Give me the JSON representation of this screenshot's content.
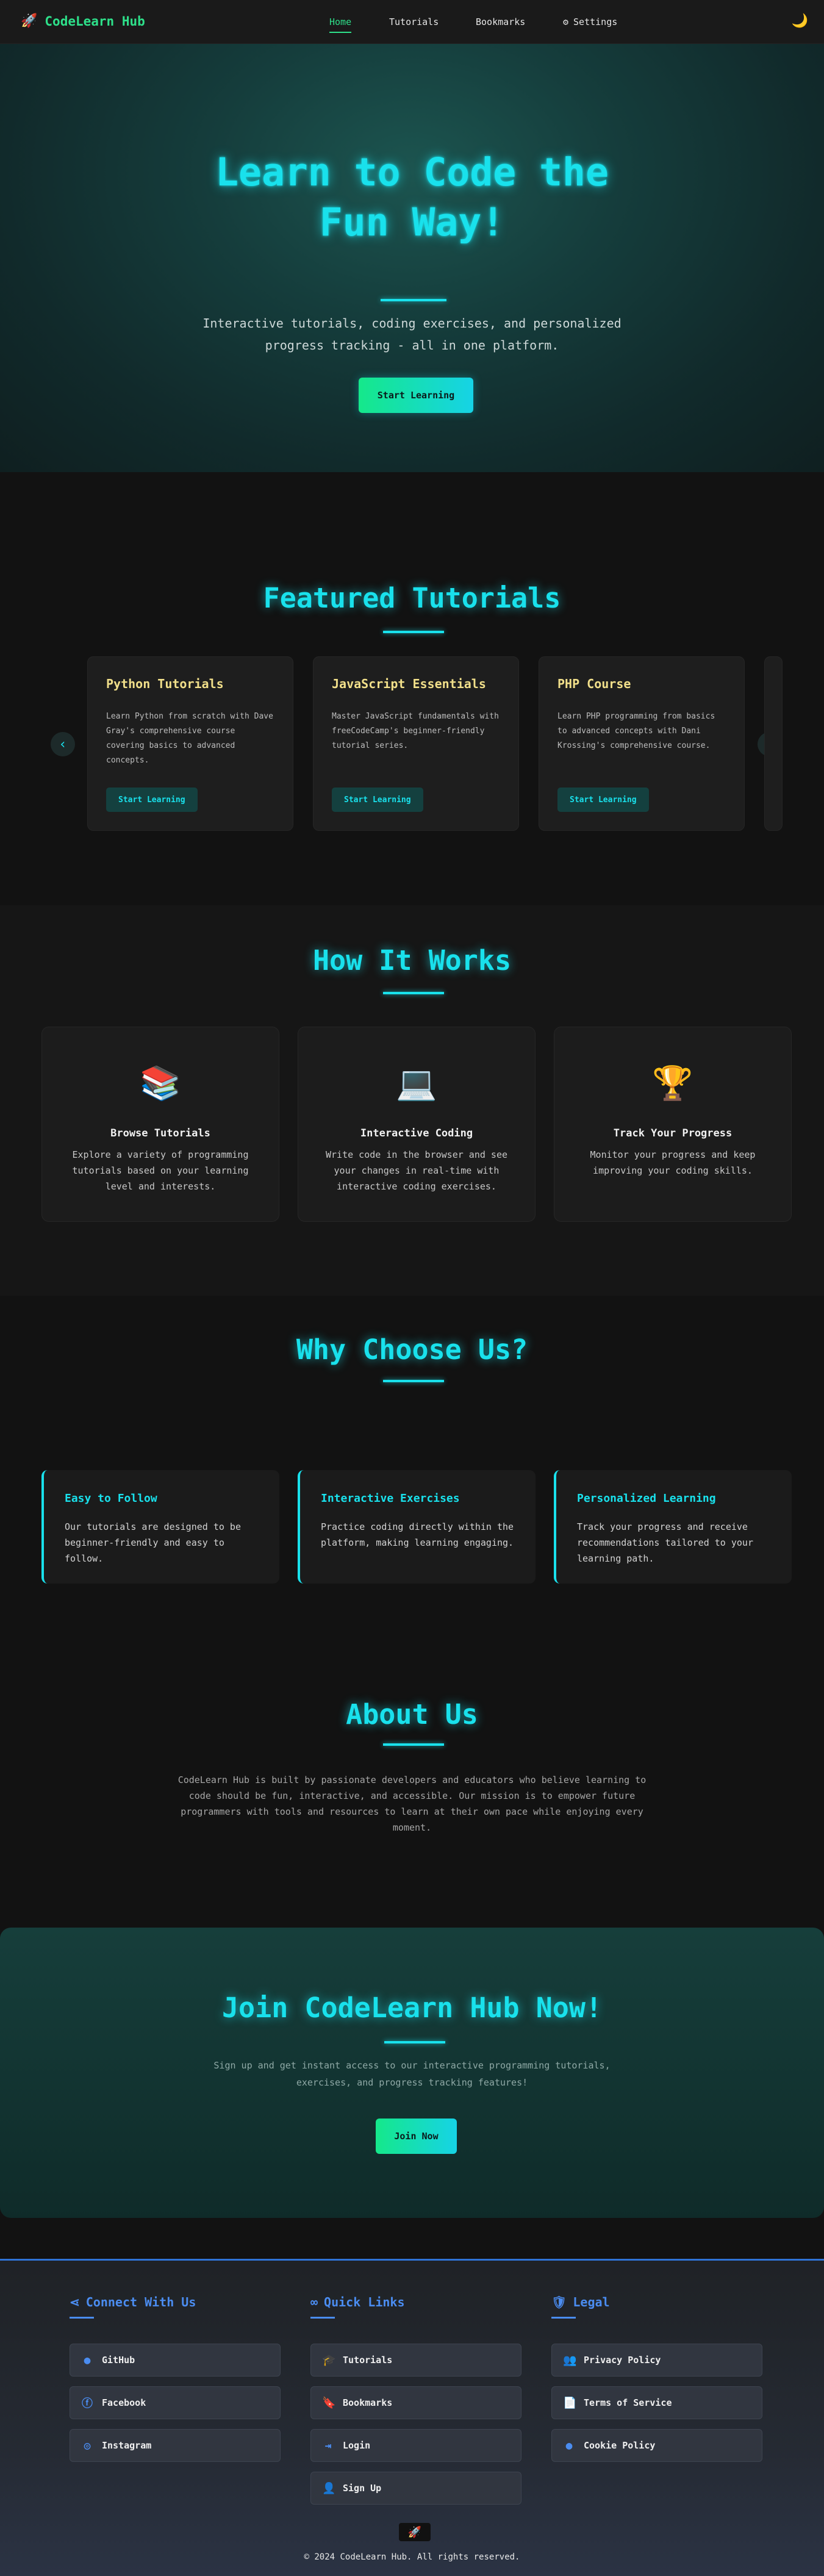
{
  "nav": {
    "brand": "CodeLearn Hub",
    "links": [
      "Home",
      "Tutorials",
      "Bookmarks",
      "Settings"
    ],
    "active": "Home"
  },
  "hero": {
    "title_line1": "Learn to Code the",
    "title_line2": "Fun Way!",
    "subtitle": "Interactive tutorials, coding exercises, and personalized progress tracking - all in one platform.",
    "cta": "Start Learning"
  },
  "featured": {
    "title": "Featured Tutorials",
    "cards": [
      {
        "title": "Python Tutorials",
        "desc": "Learn Python from scratch with Dave Gray's comprehensive course covering basics to advanced concepts.",
        "button": "Start Learning"
      },
      {
        "title": "JavaScript Essentials",
        "desc": "Master JavaScript fundamentals with freeCodeCamp's beginner-friendly tutorial series.",
        "button": "Start Learning"
      },
      {
        "title": "PHP Course",
        "desc": "Learn PHP programming from basics to advanced concepts with Dani Krossing's comprehensive course.",
        "button": "Start Learning"
      }
    ]
  },
  "how": {
    "title": "How It Works",
    "cards": [
      {
        "emoji": "📚",
        "title": "Browse Tutorials",
        "desc": "Explore a variety of programming tutorials based on your learning level and interests."
      },
      {
        "emoji": "💻",
        "title": "Interactive Coding",
        "desc": "Write code in the browser and see your changes in real-time with interactive coding exercises."
      },
      {
        "emoji": "🏆",
        "title": "Track Your Progress",
        "desc": "Monitor your progress and keep improving your coding skills."
      }
    ]
  },
  "why": {
    "title": "Why Choose Us?",
    "cards": [
      {
        "title": "Easy to Follow",
        "desc": "Our tutorials are designed to be beginner-friendly and easy to follow."
      },
      {
        "title": "Interactive Exercises",
        "desc": "Practice coding directly within the platform, making learning engaging."
      },
      {
        "title": "Personalized Learning",
        "desc": "Track your progress and receive recommendations tailored to your learning path."
      }
    ]
  },
  "about": {
    "title": "About Us",
    "text": "CodeLearn Hub is built by passionate developers and educators who believe learning to code should be fun, interactive, and accessible. Our mission is to empower future programmers with tools and resources to learn at their own pace while enjoying every moment."
  },
  "join": {
    "title": "Join CodeLearn Hub Now!",
    "text": "Sign up and get instant access to our interactive programming tutorials, exercises, and progress tracking features!",
    "cta": "Join Now"
  },
  "footer": {
    "connect": {
      "title": "Connect With Us",
      "links": [
        "GitHub",
        "Facebook",
        "Instagram"
      ]
    },
    "quick": {
      "title": "Quick Links",
      "links": [
        "Tutorials",
        "Bookmarks",
        "Login",
        "Sign Up"
      ]
    },
    "legal": {
      "title": "Legal",
      "links": [
        "Privacy Policy",
        "Terms of Service",
        "Cookie Policy"
      ]
    },
    "copyright": "© 2024 CodeLearn Hub. All rights reserved."
  },
  "colors": {
    "accent": "#19e1ec",
    "brand": "#2ee08a",
    "footer_accent": "#4a8cf0"
  }
}
